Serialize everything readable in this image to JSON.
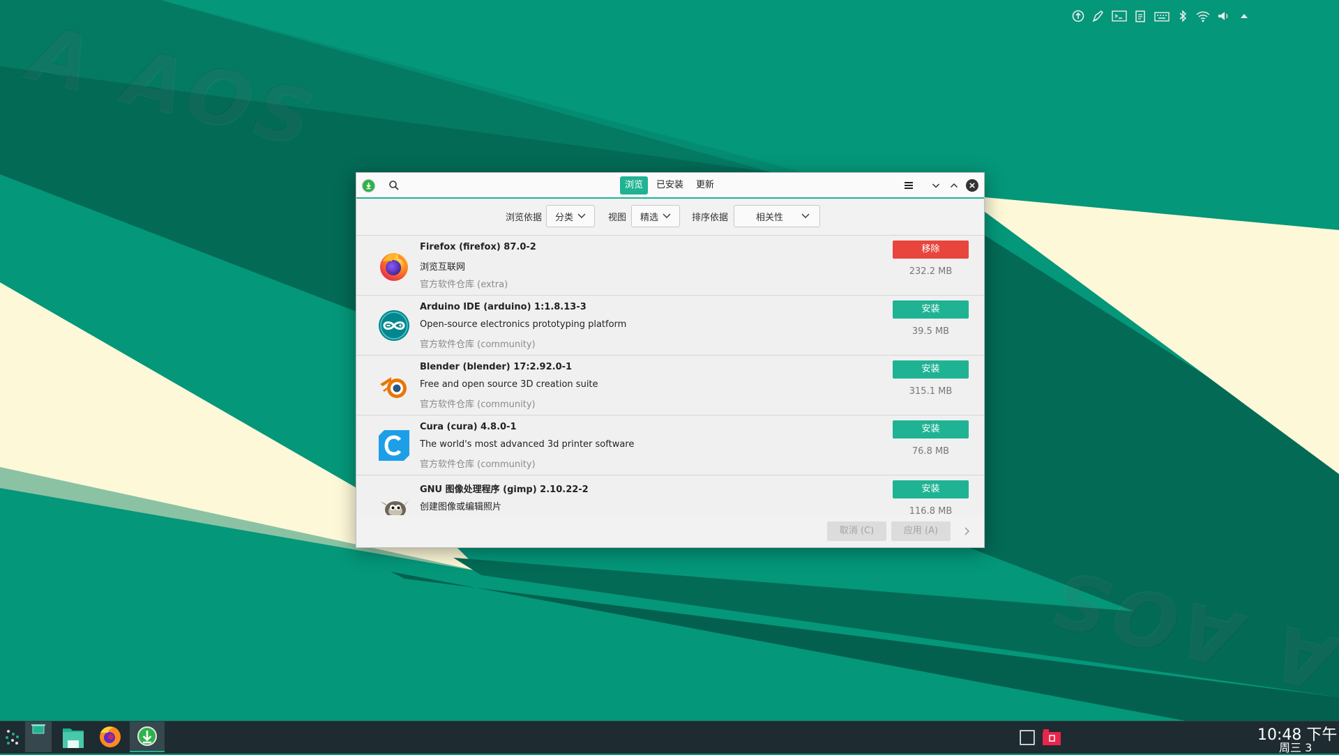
{
  "desktop": {
    "watermark_top": "A AOS",
    "watermark_bottom": "A AOS"
  },
  "window": {
    "tabs": [
      {
        "label": "浏览",
        "active": true
      },
      {
        "label": "已安装",
        "active": false
      },
      {
        "label": "更新",
        "active": false
      }
    ],
    "filter": {
      "browse_by_label": "浏览依据",
      "browse_by_value": "分类",
      "view_label": "视图",
      "view_value": "精选",
      "sort_label": "排序依据",
      "sort_value": "相关性"
    },
    "packages": [
      {
        "title": "Firefox (firefox)  87.0-2",
        "description": "浏览互联网",
        "repo": "官方软件仓库 (extra)",
        "action": "移除",
        "action_type": "remove",
        "size": "232.2 MB",
        "icon": "firefox-icon"
      },
      {
        "title": "Arduino IDE (arduino)  1:1.8.13-3",
        "description": "Open-source electronics prototyping platform",
        "repo": "官方软件仓库 (community)",
        "action": "安装",
        "action_type": "install",
        "size": "39.5 MB",
        "icon": "arduino-icon"
      },
      {
        "title": "Blender (blender)  17:2.92.0-1",
        "description": "Free and open source 3D creation suite",
        "repo": "官方软件仓库 (community)",
        "action": "安装",
        "action_type": "install",
        "size": "315.1 MB",
        "icon": "blender-icon"
      },
      {
        "title": "Cura (cura)  4.8.0-1",
        "description": "The world's most advanced 3d printer software",
        "repo": "官方软件仓库 (community)",
        "action": "安装",
        "action_type": "install",
        "size": "76.8 MB",
        "icon": "cura-icon"
      },
      {
        "title": "GNU 图像处理程序 (gimp)  2.10.22-2",
        "description": "创建图像或编辑照片",
        "repo": "",
        "action": "安装",
        "action_type": "install",
        "size": "116.8 MB",
        "icon": "gimp-icon"
      }
    ],
    "bottom": {
      "cancel_label": "取消 (C)",
      "apply_label": "应用 (A)"
    }
  },
  "taskbar": {
    "time": "10:48 下午",
    "date": "周三 3"
  },
  "colors": {
    "accent": "#1fb393",
    "remove": "#e8453c",
    "desktop": "#04977a"
  }
}
